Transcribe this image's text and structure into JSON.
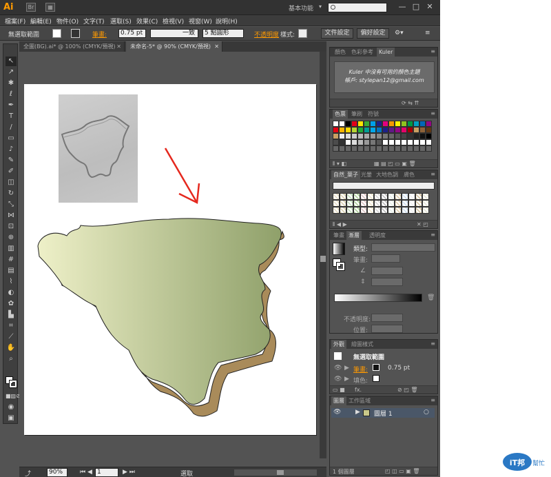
{
  "app": {
    "logo": "Ai",
    "workspace": "基本功能",
    "win_min": "—",
    "win_max": "□",
    "win_close": "✕",
    "br": "Br"
  },
  "menu": [
    "檔案(F)",
    "編輯(E)",
    "物件(O)",
    "文字(T)",
    "選取(S)",
    "效果(C)",
    "檢視(V)",
    "視窗(W)",
    "說明(H)"
  ],
  "control": {
    "selection_label": "無選取範圍",
    "stroke_label": "筆畫:",
    "stroke_value": "0.75 pt",
    "stroke_profile": "一致",
    "brush": "5 點圓形",
    "opacity_label": "不透明度",
    "style_label": "樣式:",
    "doc_setup": "文件設定",
    "preferences": "偏好設定"
  },
  "doc_tabs": [
    {
      "label": "全圖(BG).ai* @ 100% (CMYK/預視)",
      "close": "✕"
    },
    {
      "label": "未命名-5* @ 90% (CMYK/預視)",
      "close": "✕"
    }
  ],
  "status": {
    "zoom": "90%",
    "page": "1",
    "mode": "選取"
  },
  "panels": {
    "kuler": {
      "tabs": [
        "顏色",
        "色彩參考",
        "Kuler"
      ],
      "line1": "Kuler 中沒有可用的顏色主題",
      "line2": "帳戶: stylepan12@gmail.com"
    },
    "swatches": {
      "tabs": [
        "色票",
        "筆刷",
        "符號"
      ]
    },
    "library": {
      "tabs": [
        "自然_葉子",
        "光暈",
        "大地色調",
        "膚色"
      ]
    },
    "gradient": {
      "tabs": [
        "筆畫",
        "漸層",
        "透明度"
      ],
      "type_label": "類型:",
      "stroke_label": "筆畫:",
      "opacity_label": "不透明度:",
      "position_label": "位置:"
    },
    "appearance": {
      "tabs": [
        "外觀",
        "繪圖樣式"
      ],
      "title": "無選取範圍",
      "stroke_label": "筆畫:",
      "stroke_value": "0.75 pt",
      "fill_label": "填色:",
      "fx": "fx."
    },
    "layers": {
      "tabs": [
        "圖層",
        "工作區域"
      ],
      "layer_name": "圖層 1",
      "footer": "1 個圖層"
    }
  },
  "watermark": {
    "line1": "iT邦",
    "line2": "幫忙"
  },
  "colors": {
    "accent": "#ff9a00",
    "gradient_start": "#eef0c8",
    "gradient_end": "#8fa06a",
    "arrow": "#e5281e"
  }
}
